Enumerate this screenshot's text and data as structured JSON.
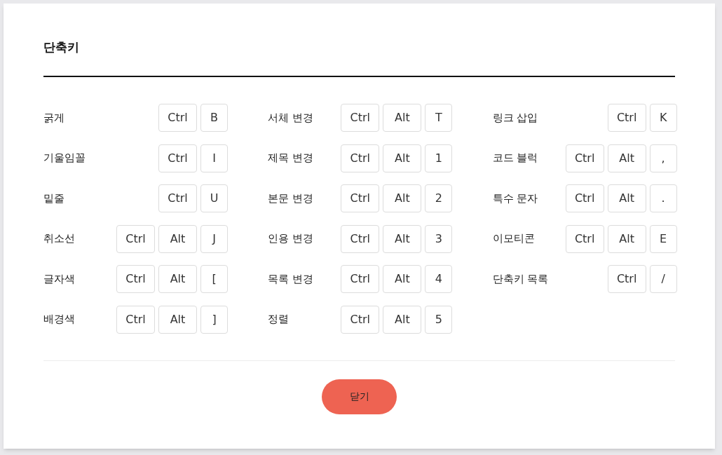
{
  "dialog": {
    "title": "단축키",
    "columns": [
      [
        {
          "label": "굵게",
          "keys": [
            "Ctrl",
            "B"
          ]
        },
        {
          "label": "기울임꼴",
          "keys": [
            "Ctrl",
            "I"
          ]
        },
        {
          "label": "밑줄",
          "keys": [
            "Ctrl",
            "U"
          ]
        },
        {
          "label": "취소선",
          "keys": [
            "Ctrl",
            "Alt",
            "J"
          ]
        },
        {
          "label": "글자색",
          "keys": [
            "Ctrl",
            "Alt",
            "["
          ]
        },
        {
          "label": "배경색",
          "keys": [
            "Ctrl",
            "Alt",
            "]"
          ]
        }
      ],
      [
        {
          "label": "서체 변경",
          "keys": [
            "Ctrl",
            "Alt",
            "T"
          ]
        },
        {
          "label": "제목 변경",
          "keys": [
            "Ctrl",
            "Alt",
            "1"
          ]
        },
        {
          "label": "본문 변경",
          "keys": [
            "Ctrl",
            "Alt",
            "2"
          ]
        },
        {
          "label": "인용 변경",
          "keys": [
            "Ctrl",
            "Alt",
            "3"
          ]
        },
        {
          "label": "목록 변경",
          "keys": [
            "Ctrl",
            "Alt",
            "4"
          ]
        },
        {
          "label": "정렬",
          "keys": [
            "Ctrl",
            "Alt",
            "5"
          ]
        }
      ],
      [
        {
          "label": "링크 삽입",
          "keys": [
            "Ctrl",
            "K"
          ]
        },
        {
          "label": "코드 블럭",
          "keys": [
            "Ctrl",
            "Alt",
            ","
          ]
        },
        {
          "label": "특수 문자",
          "keys": [
            "Ctrl",
            "Alt",
            "."
          ]
        },
        {
          "label": "이모티콘",
          "keys": [
            "Ctrl",
            "Alt",
            "E"
          ]
        },
        {
          "label": "단축키 목록",
          "keys": [
            "Ctrl",
            "/"
          ]
        }
      ]
    ],
    "close_button": "닫기"
  }
}
